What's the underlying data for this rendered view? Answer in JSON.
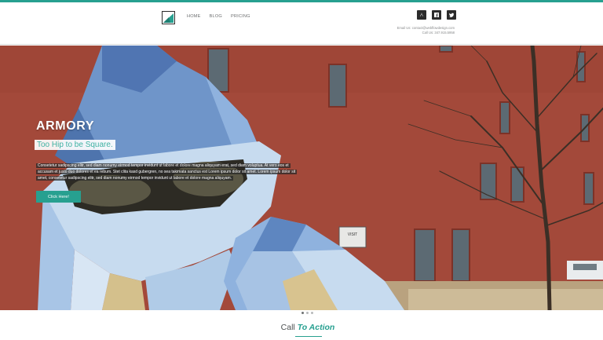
{
  "brand": {
    "accent": "#27a090",
    "logo_icon": "stacked-shape-logo"
  },
  "nav": {
    "items": [
      "HOME",
      "BLOG",
      "PRICING"
    ]
  },
  "social": {
    "icons": [
      "yelp-icon",
      "facebook-icon",
      "twitter-icon"
    ]
  },
  "contact": {
    "email_line": "Email Us: contact@webflowdesign.com",
    "phone_line": "Call Us: 347.915.5958"
  },
  "hero": {
    "title": "ARMORY",
    "subtitle": "Too Hip to be Square.",
    "body": "Consetetur sadipscing elitr, sed diam nonumy eirmod tempor invidunt ut labore et dolore magna aliquyam erat, sed diam voluptua. At vero eos et accusam et justo duo dolores et ea rebum. Stet clita kasd gubergren, no sea takimata sanctus est Lorem ipsum dolor sit amet. Lorem ipsum dolor sit amet, consetetur sadipscing elitr, sed diam nonumy eirmod tempor invidunt ut labore et dolore magna aliquyam.",
    "button_label": "Click Here!",
    "sign_text": "VISIT"
  },
  "slider": {
    "count": 3,
    "active_index": 0
  },
  "cta": {
    "prefix": "Call ",
    "emphasis": "To Action"
  }
}
